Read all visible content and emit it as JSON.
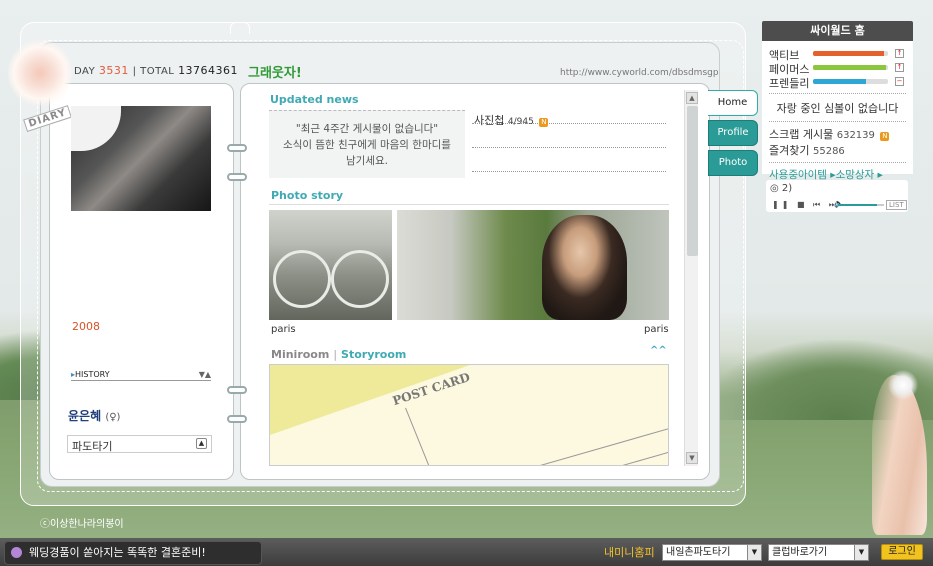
{
  "header": {
    "today_label": "DAY",
    "today_value": "3531",
    "separator": "|",
    "total_label": "TOTAL",
    "total_value": "13764361",
    "title": "그래웃자!",
    "url": "http://www.cyworld.com/dbsdmsgp",
    "diary_stamp": "DIARY"
  },
  "profile": {
    "year": "2008",
    "history_label": "HISTORY",
    "history_arrows": "▼▲",
    "name": "윤은혜",
    "gender": "(♀)",
    "mood": "파도타기",
    "mood_button": "▲"
  },
  "updated": {
    "heading": "Updated news",
    "empty_line1": "\"최근 4주간 게시물이 없습니다\"",
    "empty_line2": "소식이 뜸한 친구에게 마음의 한마디를",
    "empty_line3": "남기세요.",
    "album_label": "사진첩",
    "album_count": "4/945",
    "new_badge": "N"
  },
  "photo_story": {
    "heading": "Photo story",
    "caption_left": "paris",
    "caption_right": "paris"
  },
  "miniroom": {
    "tab_miniroom": "Miniroom",
    "tab_separator": "|",
    "tab_storyroom": "Storyroom",
    "toggle": "^^",
    "postcard_text": "POST CARD"
  },
  "tabs": [
    {
      "label": "Home"
    },
    {
      "label": "Profile"
    },
    {
      "label": "Photo"
    }
  ],
  "cyworld_home": {
    "heading": "싸이월드 홈",
    "meters": [
      {
        "label": "액티브",
        "level": 0.95,
        "color": "#e5602a",
        "indicator": "↑"
      },
      {
        "label": "페이머스",
        "level": 0.97,
        "color": "#8cc63e",
        "indicator": "↑"
      },
      {
        "label": "프렌들리",
        "level": 0.7,
        "color": "#2ea6d6",
        "indicator": "−"
      }
    ],
    "bragging": "자랑 중인 심볼이 없습니다",
    "scrap_label": "스크랩 게시물",
    "scrap_count": "632139",
    "fav_label": "즐겨찾기",
    "fav_count": "55286",
    "shop_label": "사용중아이템 ▸소망상자 ▸"
  },
  "player": {
    "song": "2)",
    "controls": "❚❚ ■ ⏮ ⏭",
    "volume_icon": "🔈",
    "list_label": "LIST",
    "volume_level": 0.85
  },
  "footer": {
    "ad_text": "웨딩경품이 쏟아지는 똑똑한 결혼준비!",
    "my_home": "내미니홈피",
    "select1": "내일촌파도타기",
    "select2": "클럽바로가기",
    "login": "로그인",
    "copyright": "ⓒ이상한나라의봉이"
  }
}
